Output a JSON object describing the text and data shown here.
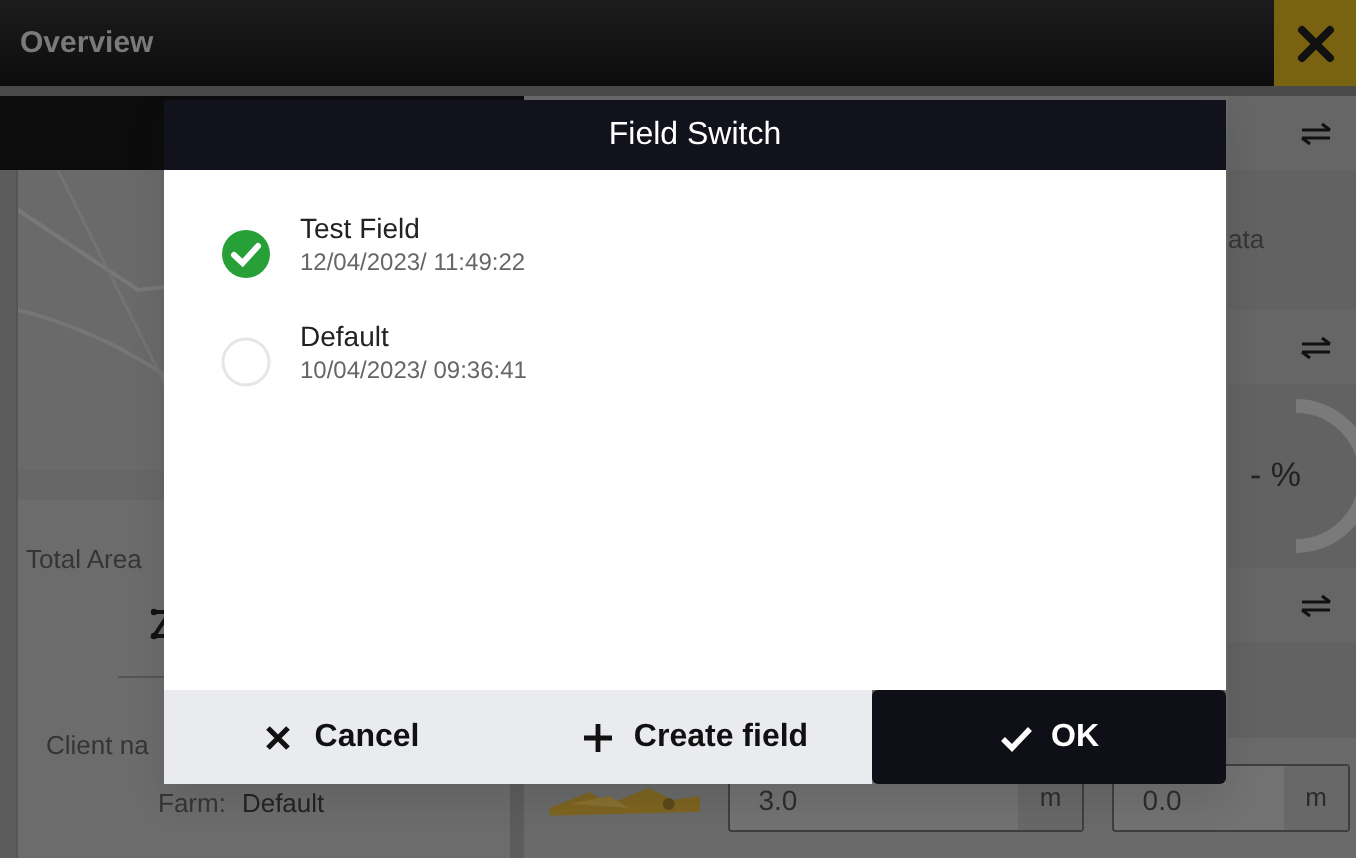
{
  "app": {
    "title": "Overview"
  },
  "left_panel": {
    "total_area_label": "Total Area",
    "client_label": "Client na",
    "farm_label": "Farm:",
    "farm_value": "Default"
  },
  "right_panel": {
    "data_label": "ata",
    "progress_reading": "- %"
  },
  "offsets": [
    {
      "value": "3.0",
      "unit": "m"
    },
    {
      "value": "0.0",
      "unit": "m"
    }
  ],
  "dialog": {
    "title": "Field Switch",
    "fields": [
      {
        "name": "Test Field",
        "timestamp": "12/04/2023/ 11:49:22",
        "selected": true
      },
      {
        "name": "Default",
        "timestamp": "10/04/2023/ 09:36:41",
        "selected": false
      }
    ],
    "buttons": [
      {
        "kind": "cancel",
        "label": "Cancel"
      },
      {
        "kind": "create",
        "label": "Create field"
      },
      {
        "kind": "ok",
        "label": "OK"
      }
    ]
  }
}
